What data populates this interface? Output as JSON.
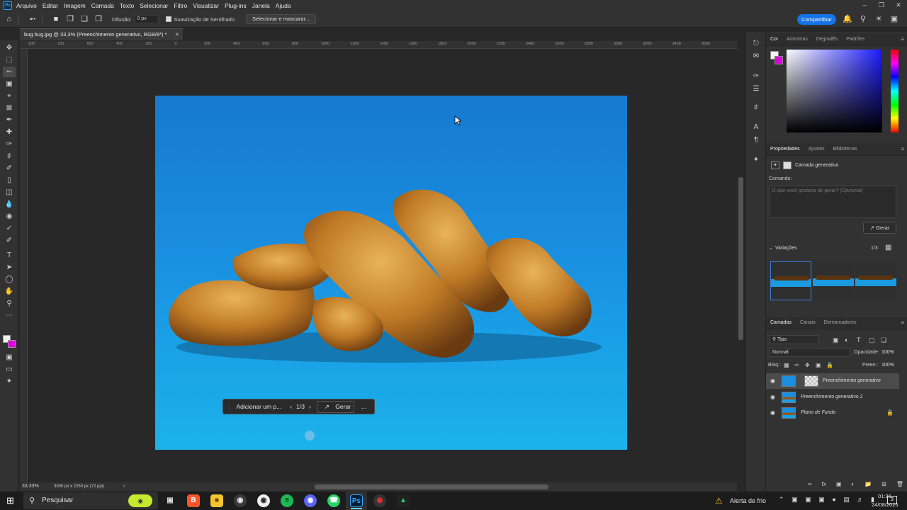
{
  "menubar": {
    "app_logo": "Ps",
    "items": [
      "Arquivo",
      "Editar",
      "Imagem",
      "Camada",
      "Texto",
      "Selecionar",
      "Filtro",
      "Visualizar",
      "Plug-ins",
      "Janela",
      "Ajuda"
    ]
  },
  "options": {
    "feather_label": "Difusão:",
    "feather_value": "0 px",
    "antialias_label": "Suavização de Serrilhado",
    "select_mask_label": "Selecionar e mascarar...",
    "share_label": "Compartilhar"
  },
  "document": {
    "tab_title": "bug bug.jpg @ 33,3% (Preenchimento generativo, RGB/8*) *"
  },
  "ruler_top": [
    "300",
    "100",
    "600",
    "400",
    "200",
    "0",
    "200",
    "400",
    "600",
    "800",
    "1000",
    "1200",
    "1400",
    "1600",
    "1800",
    "2000",
    "2200",
    "2400",
    "2600",
    "2800",
    "3000",
    "3200",
    "3400",
    "3600"
  ],
  "context_bar": {
    "prompt_placeholder": "Adicionar um p...",
    "counter": "1/3",
    "generate_label": "Gerar",
    "more_label": "..."
  },
  "status": {
    "zoom": "33,33%",
    "doc_size": "3000 px x 2250 px (72 ppi)"
  },
  "color_panel": {
    "tabs": [
      "Cor",
      "Amostras",
      "Degradês",
      "Padrões"
    ],
    "foreground": "#f2f2f2",
    "background": "#e000e0"
  },
  "properties_panel": {
    "tabs": [
      "Propriedades",
      "Ajustes",
      "Bibliotecas"
    ],
    "layer_type": "Camada generativa",
    "prompt_label": "Comando:",
    "prompt_placeholder": "O que você gostaria de gerar? (Opcional)",
    "generate_label": "Gerar",
    "variations_label": "Variações",
    "variations_counter": "1/3"
  },
  "layers_panel": {
    "tabs": [
      "Camadas",
      "Canais",
      "Demarcadores"
    ],
    "filter_kind": "Tipo",
    "blend_mode": "Normal",
    "opacity_label": "Opacidade:",
    "opacity_value": "100%",
    "lock_label": "Bloq.:",
    "fill_label": "Preen.:",
    "fill_value": "100%",
    "layers": [
      {
        "name": "Preenchimento generativo",
        "selected": true
      },
      {
        "name": "Preenchimento generativo 2",
        "selected": false
      },
      {
        "name": "Plano de Fundo",
        "selected": false,
        "locked": true
      }
    ]
  },
  "taskbar": {
    "search_placeholder": "Pesquisar",
    "weather": "Alerta de frio",
    "time": "01:36",
    "date": "24/08/2025",
    "notification_count": "3"
  }
}
